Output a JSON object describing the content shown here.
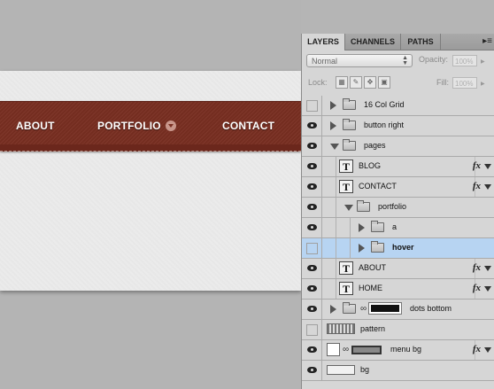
{
  "canvas": {
    "menu": {
      "about": "ABOUT",
      "portfolio": "PORTFOLIO",
      "contact": "CONTACT"
    },
    "colors": {
      "menu_bg": "#7a2f22",
      "page_bg": "#ebebeb",
      "workspace_bg": "#b4b4b4"
    }
  },
  "panel": {
    "tabs": [
      "LAYERS",
      "CHANNELS",
      "PATHS"
    ],
    "menu_icon": "panel-menu-icon",
    "blend_mode": "Normal",
    "opacity_label": "Opacity:",
    "opacity_value": "100%",
    "lock_label": "Lock:",
    "fill_label": "Fill:",
    "fill_value": "100%",
    "selected_color": "#b7d4f2",
    "layers": [
      {
        "name": "16 Col Grid",
        "kind": "group",
        "visible": false,
        "expanded": false,
        "depth": 0,
        "fx": false
      },
      {
        "name": "button right",
        "kind": "group",
        "visible": true,
        "expanded": false,
        "depth": 0,
        "fx": false
      },
      {
        "name": "pages",
        "kind": "group",
        "visible": true,
        "expanded": true,
        "depth": 0,
        "fx": false
      },
      {
        "name": "BLOG",
        "kind": "text",
        "visible": true,
        "depth": 1,
        "fx": true,
        "fx_label": "fx"
      },
      {
        "name": "CONTACT",
        "kind": "text",
        "visible": true,
        "depth": 1,
        "fx": true,
        "fx_label": "fx"
      },
      {
        "name": "portfolio",
        "kind": "group",
        "visible": true,
        "expanded": true,
        "depth": 1,
        "fx": false
      },
      {
        "name": "a",
        "kind": "group",
        "visible": true,
        "expanded": false,
        "depth": 2,
        "fx": false
      },
      {
        "name": "hover",
        "kind": "group",
        "visible": false,
        "expanded": false,
        "depth": 2,
        "fx": false,
        "selected": true
      },
      {
        "name": "ABOUT",
        "kind": "text",
        "visible": true,
        "depth": 1,
        "fx": true,
        "fx_label": "fx"
      },
      {
        "name": "HOME",
        "kind": "text",
        "visible": true,
        "depth": 1,
        "fx": true,
        "fx_label": "fx"
      },
      {
        "name": "dots bottom",
        "kind": "group-masked",
        "visible": true,
        "expanded": false,
        "depth": 0,
        "fx": false
      },
      {
        "name": "pattern",
        "kind": "pattern",
        "visible": false,
        "depth": 0,
        "fx": false
      },
      {
        "name": "menu bg",
        "kind": "shape",
        "visible": true,
        "depth": 0,
        "fx": true,
        "fx_label": "fx"
      },
      {
        "name": "bg",
        "kind": "shape",
        "visible": true,
        "depth": 0,
        "fx": false
      }
    ]
  }
}
